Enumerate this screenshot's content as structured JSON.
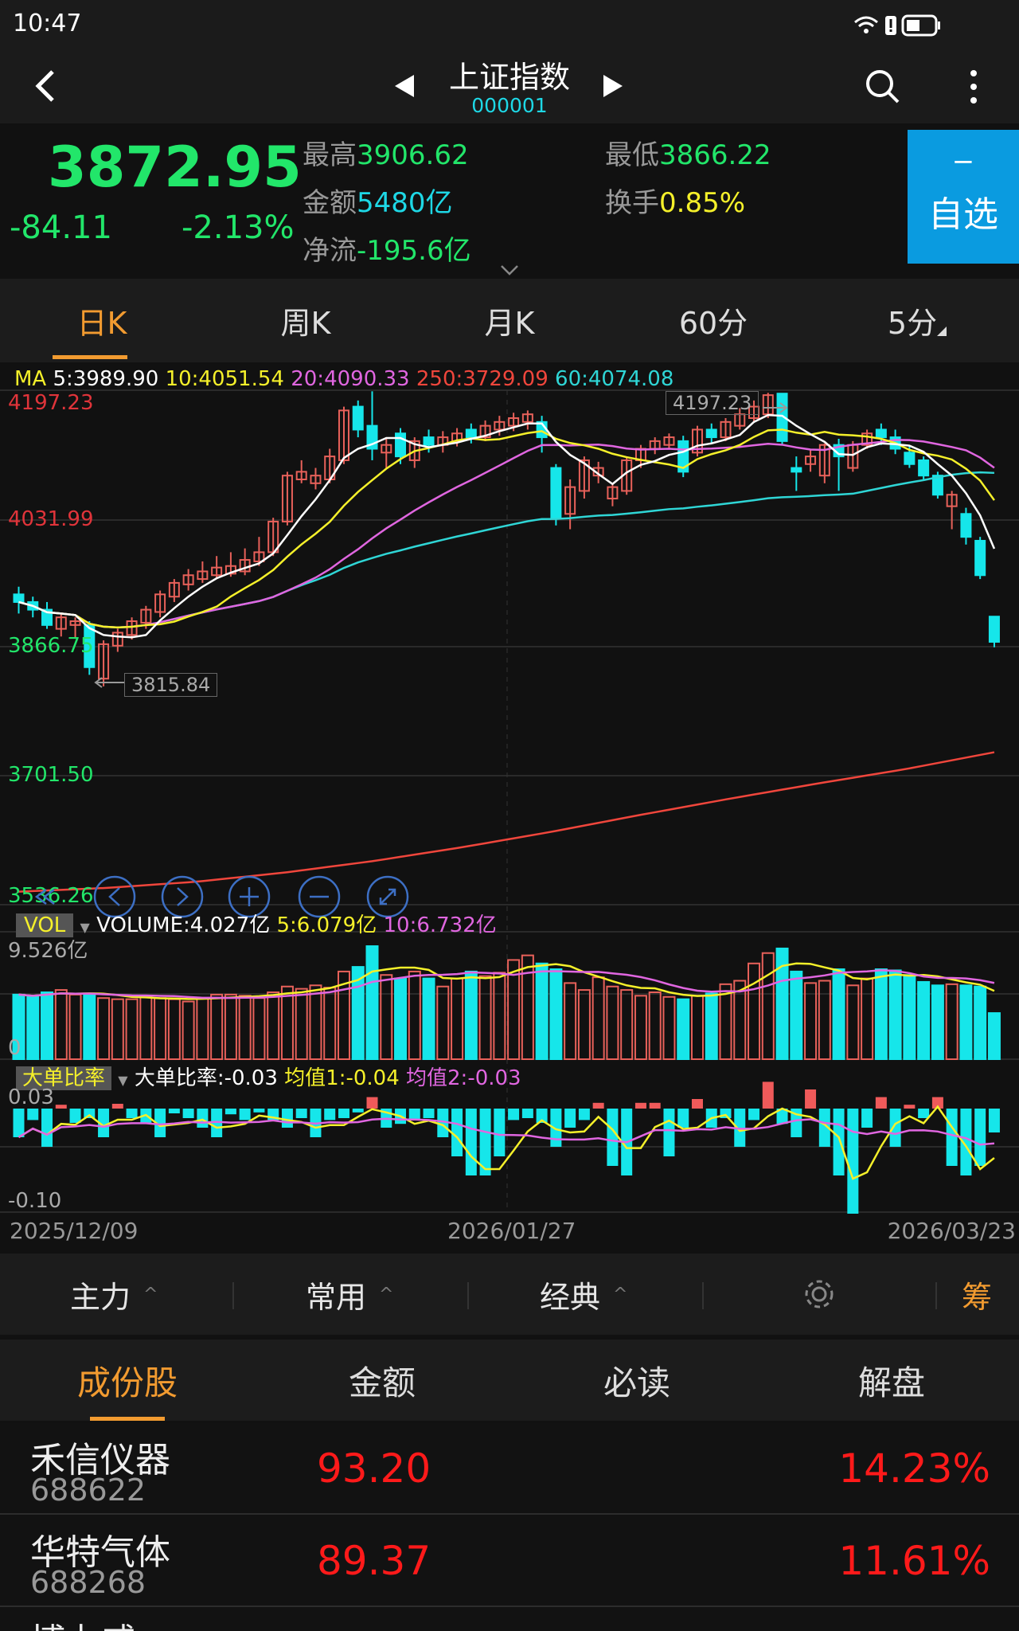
{
  "status": {
    "time": "10:47"
  },
  "header": {
    "title": "上证指数",
    "code": "000001"
  },
  "quote": {
    "price": "3872.95",
    "change": "-84.11",
    "change_pct": "-2.13%",
    "high_label": "最高",
    "high": "3906.62",
    "low_label": "最低",
    "low": "3866.22",
    "amount_label": "金额",
    "amount": "5480亿",
    "turnover_label": "换手",
    "turnover": "0.85%",
    "netflow_label": "净流",
    "netflow": "-195.6亿",
    "watch_button": {
      "symbol": "−",
      "label": "自选"
    }
  },
  "periods": [
    {
      "label": "日K",
      "active": true
    },
    {
      "label": "周K"
    },
    {
      "label": "月K"
    },
    {
      "label": "60分"
    },
    {
      "label": "5分"
    }
  ],
  "colors": {
    "up": "#e8615a",
    "down": "#16e6ea",
    "green": "#22e66a",
    "ma5": "#ffffff",
    "ma10": "#f5f02a",
    "ma20": "#e066e0",
    "ma60": "#2fd6d6",
    "ma250": "#f0463c",
    "accent": "#f29b30",
    "button": "#0a9be0"
  },
  "chart_data": {
    "type": "candlestick",
    "ma_legend": {
      "prefix": "MA",
      "ma5": "5:3989.90",
      "ma10": "10:4051.54",
      "ma20": "20:4090.33",
      "ma250": "250:3729.09",
      "ma60": "60:4074.08"
    },
    "y_ticks": [
      "4197.23",
      "4031.99",
      "3866.75",
      "3701.50",
      "3536.26"
    ],
    "ylim": [
      3536.26,
      4197.23
    ],
    "max_marker": "4197.23",
    "min_marker": "3815.84",
    "ohlc": [
      [
        3935,
        3945,
        3910,
        3925
      ],
      [
        3925,
        3932,
        3905,
        3915
      ],
      [
        3915,
        3925,
        3890,
        3895
      ],
      [
        3890,
        3910,
        3880,
        3905
      ],
      [
        3895,
        3905,
        3878,
        3900
      ],
      [
        3895,
        3900,
        3830,
        3840
      ],
      [
        3825,
        3875,
        3815,
        3870
      ],
      [
        3868,
        3890,
        3860,
        3885
      ],
      [
        3882,
        3905,
        3876,
        3900
      ],
      [
        3898,
        3920,
        3890,
        3915
      ],
      [
        3912,
        3940,
        3905,
        3935
      ],
      [
        3932,
        3955,
        3925,
        3950
      ],
      [
        3948,
        3968,
        3940,
        3960
      ],
      [
        3955,
        3978,
        3950,
        3965
      ],
      [
        3960,
        3985,
        3955,
        3970
      ],
      [
        3962,
        3990,
        3958,
        3972
      ],
      [
        3965,
        3995,
        3960,
        3980
      ],
      [
        3978,
        4010,
        3972,
        3990
      ],
      [
        3990,
        4035,
        3985,
        4030
      ],
      [
        4030,
        4095,
        4025,
        4090
      ],
      [
        4085,
        4110,
        4080,
        4095
      ],
      [
        4080,
        4100,
        4072,
        4090
      ],
      [
        4085,
        4125,
        4080,
        4115
      ],
      [
        4110,
        4180,
        4105,
        4175
      ],
      [
        4180,
        4188,
        4140,
        4150
      ],
      [
        4155,
        4200,
        4110,
        4125
      ],
      [
        4120,
        4140,
        4100,
        4130
      ],
      [
        4145,
        4152,
        4105,
        4115
      ],
      [
        4110,
        4140,
        4100,
        4135
      ],
      [
        4140,
        4150,
        4120,
        4130
      ],
      [
        4130,
        4148,
        4120,
        4140
      ],
      [
        4135,
        4152,
        4128,
        4145
      ],
      [
        4150,
        4158,
        4132,
        4140
      ],
      [
        4140,
        4162,
        4135,
        4155
      ],
      [
        4150,
        4168,
        4142,
        4160
      ],
      [
        4155,
        4172,
        4148,
        4165
      ],
      [
        4160,
        4175,
        4150,
        4170
      ],
      [
        4160,
        4168,
        4120,
        4140
      ],
      [
        4100,
        4105,
        4025,
        4035
      ],
      [
        4040,
        4085,
        4020,
        4075
      ],
      [
        4070,
        4115,
        4060,
        4110
      ],
      [
        4090,
        4108,
        4080,
        4100
      ],
      [
        4060,
        4080,
        4050,
        4075
      ],
      [
        4070,
        4115,
        4065,
        4110
      ],
      [
        4110,
        4130,
        4100,
        4125
      ],
      [
        4125,
        4140,
        4118,
        4135
      ],
      [
        4130,
        4145,
        4125,
        4140
      ],
      [
        4135,
        4142,
        4088,
        4095
      ],
      [
        4120,
        4155,
        4115,
        4150
      ],
      [
        4150,
        4158,
        4132,
        4140
      ],
      [
        4140,
        4165,
        4135,
        4160
      ],
      [
        4155,
        4178,
        4150,
        4170
      ],
      [
        4165,
        4188,
        4160,
        4180
      ],
      [
        4170,
        4198,
        4165,
        4195
      ],
      [
        4197,
        4197,
        4130,
        4135
      ],
      [
        4100,
        4115,
        4070,
        4095
      ],
      [
        4105,
        4125,
        4095,
        4115
      ],
      [
        4090,
        4132,
        4080,
        4130
      ],
      [
        4130,
        4138,
        4070,
        4115
      ],
      [
        4100,
        4135,
        4095,
        4130
      ],
      [
        4130,
        4150,
        4125,
        4145
      ],
      [
        4150,
        4158,
        4130,
        4140
      ],
      [
        4140,
        4150,
        4118,
        4125
      ],
      [
        4120,
        4128,
        4100,
        4105
      ],
      [
        4110,
        4115,
        4085,
        4090
      ],
      [
        4090,
        4095,
        4060,
        4065
      ],
      [
        4050,
        4070,
        4020,
        4065
      ],
      [
        4040,
        4048,
        4000,
        4010
      ],
      [
        4005,
        4010,
        3955,
        3960
      ],
      [
        3906,
        3906,
        3866,
        3873
      ]
    ],
    "ma250": [
      3547,
      3552,
      3560,
      3572,
      3587,
      3605,
      3625,
      3647,
      3668,
      3688,
      3707,
      3729
    ],
    "volume": {
      "legend": {
        "tag": "VOL",
        "volume": "VOLUME:4.027亿",
        "ma5": "5:6.079亿",
        "ma10": "10:6.732亿"
      },
      "y_ticks": [
        "9.526亿",
        "0"
      ],
      "max": 9.526,
      "values": [
        5.6,
        5.4,
        5.8,
        6.0,
        5.6,
        5.7,
        5.3,
        5.2,
        5.2,
        5.4,
        5.3,
        5.2,
        5.0,
        5.3,
        5.6,
        5.6,
        5.5,
        5.3,
        5.8,
        6.3,
        6.1,
        6.4,
        6.2,
        7.6,
        8.0,
        9.8,
        7.3,
        7.0,
        7.6,
        7.0,
        6.3,
        7.0,
        7.6,
        7.2,
        7.5,
        8.6,
        9.0,
        8.3,
        7.8,
        6.6,
        6.0,
        7.1,
        6.3,
        6.0,
        5.5,
        5.8,
        5.4,
        5.2,
        5.5,
        5.7,
        6.5,
        6.8,
        8.3,
        9.2,
        9.6,
        7.6,
        6.6,
        6.8,
        7.8,
        6.4,
        7.0,
        7.8,
        7.7,
        7.3,
        6.7,
        6.4,
        6.5,
        6.4,
        6.3,
        4.0
      ]
    },
    "big_order": {
      "legend": {
        "tag": "大单比率",
        "value": "大单比率:-0.03",
        "avg1": "均值1:-0.04",
        "avg2": "均值2:-0.03"
      },
      "y_ticks": [
        "0.03",
        "-0.10"
      ],
      "ylim": [
        -0.11,
        0.03
      ],
      "values": [
        -0.03,
        -0.012,
        -0.04,
        0.004,
        -0.015,
        -0.01,
        -0.03,
        0.005,
        -0.01,
        -0.015,
        -0.03,
        -0.005,
        -0.01,
        -0.02,
        -0.03,
        -0.006,
        -0.012,
        -0.004,
        -0.012,
        -0.02,
        -0.01,
        -0.03,
        -0.012,
        -0.01,
        -0.004,
        0.012,
        -0.02,
        -0.016,
        -0.012,
        -0.01,
        -0.03,
        -0.05,
        -0.07,
        -0.07,
        -0.05,
        -0.012,
        -0.01,
        -0.015,
        -0.04,
        -0.02,
        -0.012,
        0.006,
        -0.06,
        -0.07,
        0.006,
        0.006,
        -0.05,
        -0.02,
        0.01,
        -0.02,
        -0.01,
        -0.04,
        -0.012,
        0.028,
        -0.016,
        -0.03,
        0.02,
        -0.04,
        -0.07,
        -0.11,
        -0.02,
        0.012,
        -0.04,
        0.004,
        -0.01,
        0.012,
        -0.06,
        -0.07,
        -0.06,
        -0.025
      ]
    },
    "x_ticks": [
      "2025/12/09",
      "2026/01/27",
      "2026/03/23"
    ]
  },
  "toolbar": {
    "items": [
      "主力",
      "常用",
      "经典"
    ],
    "chip": "筹"
  },
  "list_tabs": [
    {
      "label": "成份股",
      "active": true
    },
    {
      "label": "金额"
    },
    {
      "label": "必读"
    },
    {
      "label": "解盘"
    }
  ],
  "stocks": [
    {
      "name": "禾信仪器",
      "code": "688622",
      "price": "93.20",
      "pct": "14.23%"
    },
    {
      "name": "华特气体",
      "code": "688268",
      "price": "89.37",
      "pct": "11.61%"
    },
    {
      "name": "博力威"
    }
  ]
}
